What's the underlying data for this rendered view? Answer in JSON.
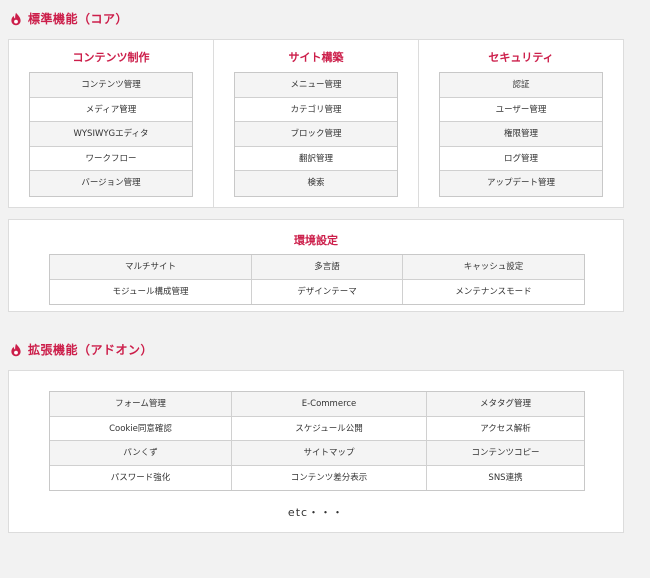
{
  "core": {
    "heading": "標準機能（コア）",
    "icon": "flame-icon",
    "columns": [
      {
        "title": "コンテンツ制作",
        "items": [
          "コンテンツ管理",
          "メディア管理",
          "WYSIWYGエディタ",
          "ワークフロー",
          "バージョン管理"
        ]
      },
      {
        "title": "サイト構築",
        "items": [
          "メニュー管理",
          "カテゴリ管理",
          "ブロック管理",
          "翻訳管理",
          "検索"
        ]
      },
      {
        "title": "セキュリティ",
        "items": [
          "認証",
          "ユーザー管理",
          "権限管理",
          "ログ管理",
          "アップデート管理"
        ]
      }
    ],
    "environment": {
      "title": "環境設定",
      "rows": [
        [
          "マルチサイト",
          "多言語",
          "キャッシュ設定"
        ],
        [
          "モジュール構成管理",
          "デザインテーマ",
          "メンテナンスモード"
        ]
      ]
    }
  },
  "addon": {
    "heading": "拡張機能（アドオン）",
    "icon": "flame-icon",
    "rows": [
      [
        "フォーム管理",
        "E-Commerce",
        "メタタグ管理"
      ],
      [
        "Cookie同意確認",
        "スケジュール公開",
        "アクセス解析"
      ],
      [
        "パンくず",
        "サイトマップ",
        "コンテンツコピー"
      ],
      [
        "パスワード強化",
        "コンテンツ差分表示",
        "SNS連携"
      ]
    ],
    "etc": "etc・・・"
  },
  "colors": {
    "accent": "#cc1e4a",
    "border": "#dcdcdc",
    "cell_alt": "#f4f4f4"
  }
}
